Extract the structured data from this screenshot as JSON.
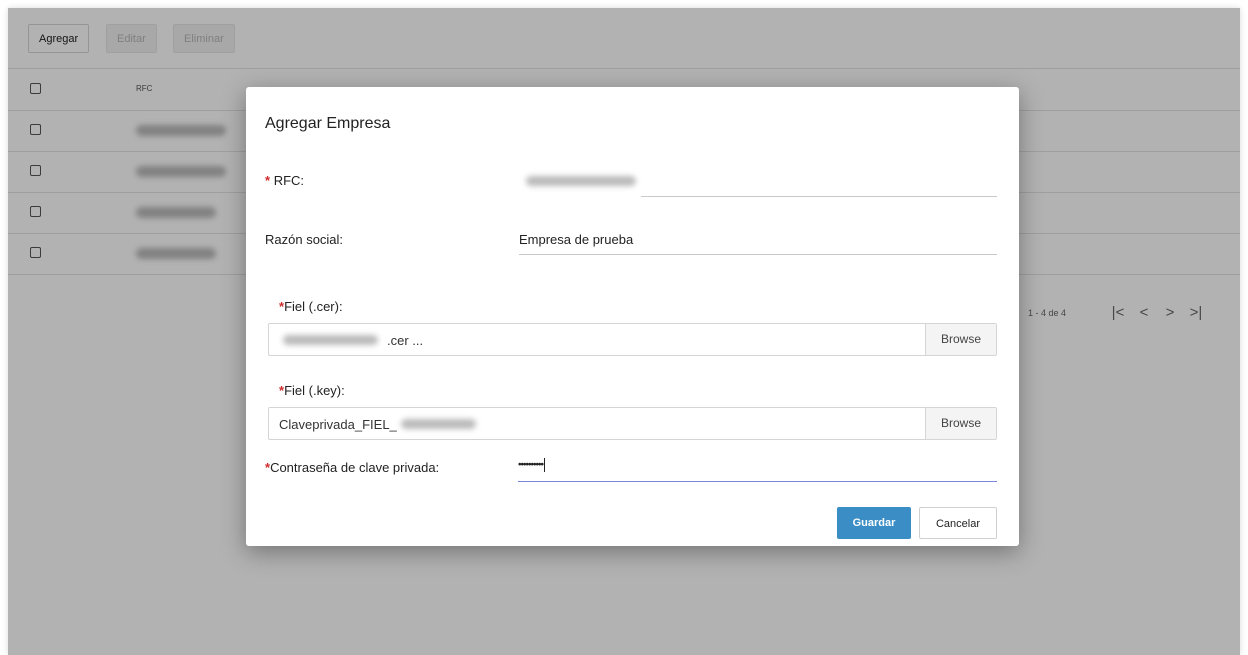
{
  "toolbar": {
    "add_label": "Agregar",
    "edit_label": "Editar",
    "delete_label": "Eliminar"
  },
  "table": {
    "column_rfc": "RFC",
    "row_count": 4
  },
  "pagination": {
    "range_text": "1 - 4 de 4",
    "first_icon": "|<",
    "prev_icon": "<",
    "next_icon": ">",
    "last_icon": ">|"
  },
  "modal": {
    "title": "Agregar Empresa",
    "required_mark": "*",
    "rfc_label": "RFC:",
    "razon_label": "Razón social:",
    "razon_value": "Empresa de prueba",
    "fiel_cer_label": "Fiel (.cer):",
    "fiel_cer_value": ".cer ...",
    "fiel_key_label": "Fiel (.key):",
    "fiel_key_value": "Claveprivada_FIEL_",
    "browse_label": "Browse",
    "password_label": "Contraseña de clave privada:",
    "password_value": "••••••••••",
    "save_label": "Guardar",
    "cancel_label": "Cancelar"
  },
  "colors": {
    "primary": "#3b8ec5",
    "required": "#d12b2b",
    "focus_underline": "#7c86d8"
  }
}
